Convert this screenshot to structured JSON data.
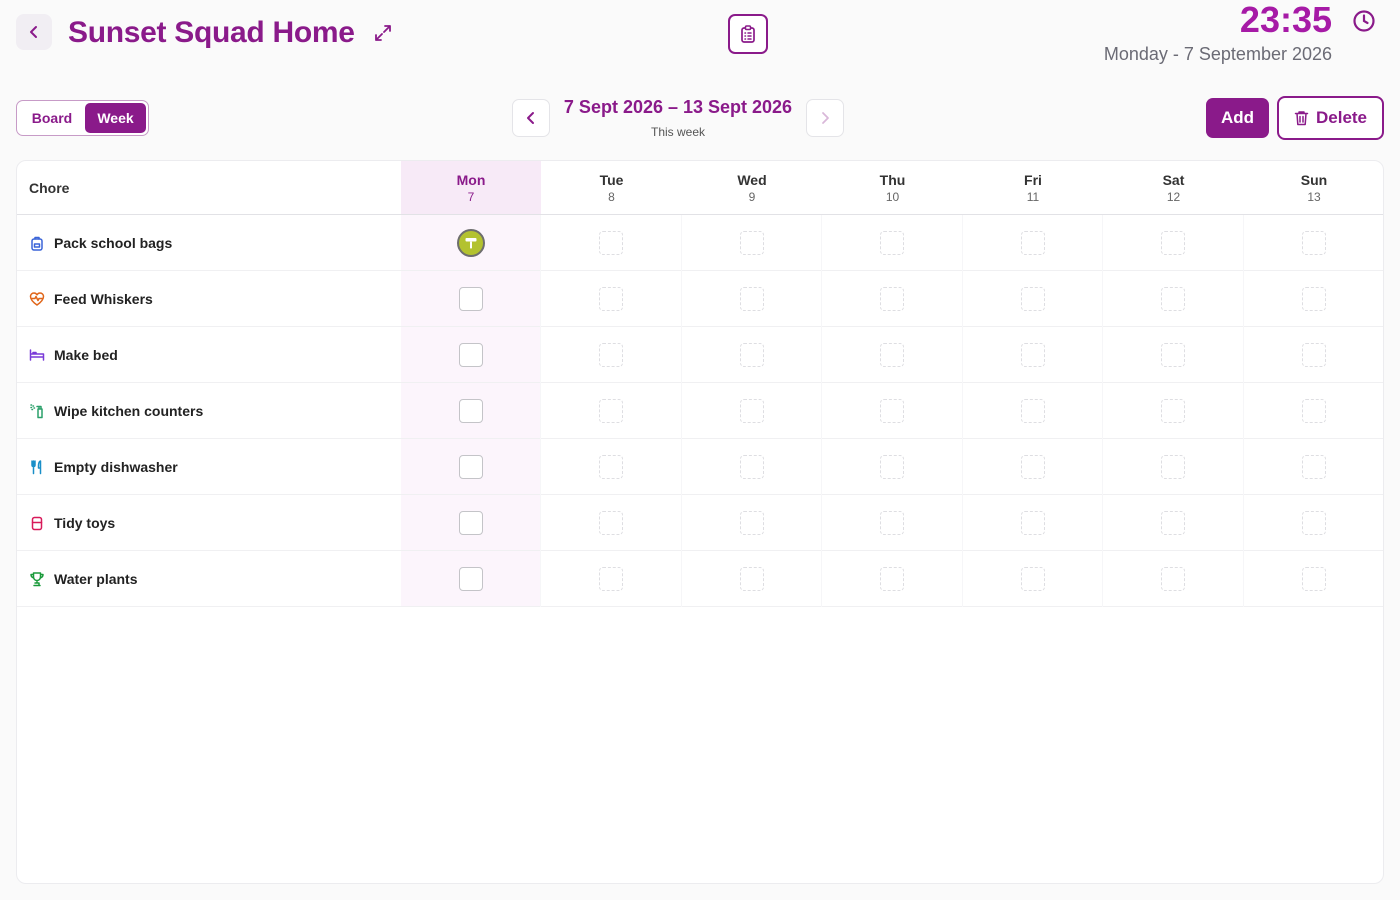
{
  "header": {
    "title": "Sunset Squad Home",
    "time": "23:35",
    "date": "Monday - 7 September 2026"
  },
  "toolbar": {
    "view_board": "Board",
    "view_week": "Week",
    "week_range": "7 Sept 2026 – 13 Sept 2026",
    "week_sub": "This week",
    "add_label": "Add",
    "delete_label": "Delete"
  },
  "table": {
    "chore_header": "Chore",
    "days": [
      {
        "name": "Mon",
        "date": "7"
      },
      {
        "name": "Tue",
        "date": "8"
      },
      {
        "name": "Wed",
        "date": "9"
      },
      {
        "name": "Thu",
        "date": "10"
      },
      {
        "name": "Fri",
        "date": "11"
      },
      {
        "name": "Sat",
        "date": "12"
      },
      {
        "name": "Sun",
        "date": "13"
      }
    ],
    "chores": [
      {
        "name": "Pack school bags",
        "icon": "backpack-icon",
        "icon_color": "#3a64d8",
        "mon_done": true
      },
      {
        "name": "Feed Whiskers",
        "icon": "heart-pulse-icon",
        "icon_color": "#e0661a",
        "mon_done": false
      },
      {
        "name": "Make bed",
        "icon": "bed-icon",
        "icon_color": "#7a3ad8",
        "mon_done": false
      },
      {
        "name": "Wipe kitchen counters",
        "icon": "spray-bottle-icon",
        "icon_color": "#2aa06a",
        "mon_done": false
      },
      {
        "name": "Empty dishwasher",
        "icon": "utensils-icon",
        "icon_color": "#1a8fc8",
        "mon_done": false
      },
      {
        "name": "Tidy toys",
        "icon": "toy-box-icon",
        "icon_color": "#d81a5a",
        "mon_done": false
      },
      {
        "name": "Water plants",
        "icon": "trophy-icon",
        "icon_color": "#1a9a3a",
        "mon_done": false
      }
    ]
  },
  "colors": {
    "accent": "#8a1a8a",
    "clock": "#a61aa6",
    "avatar": "#b3c22f"
  }
}
